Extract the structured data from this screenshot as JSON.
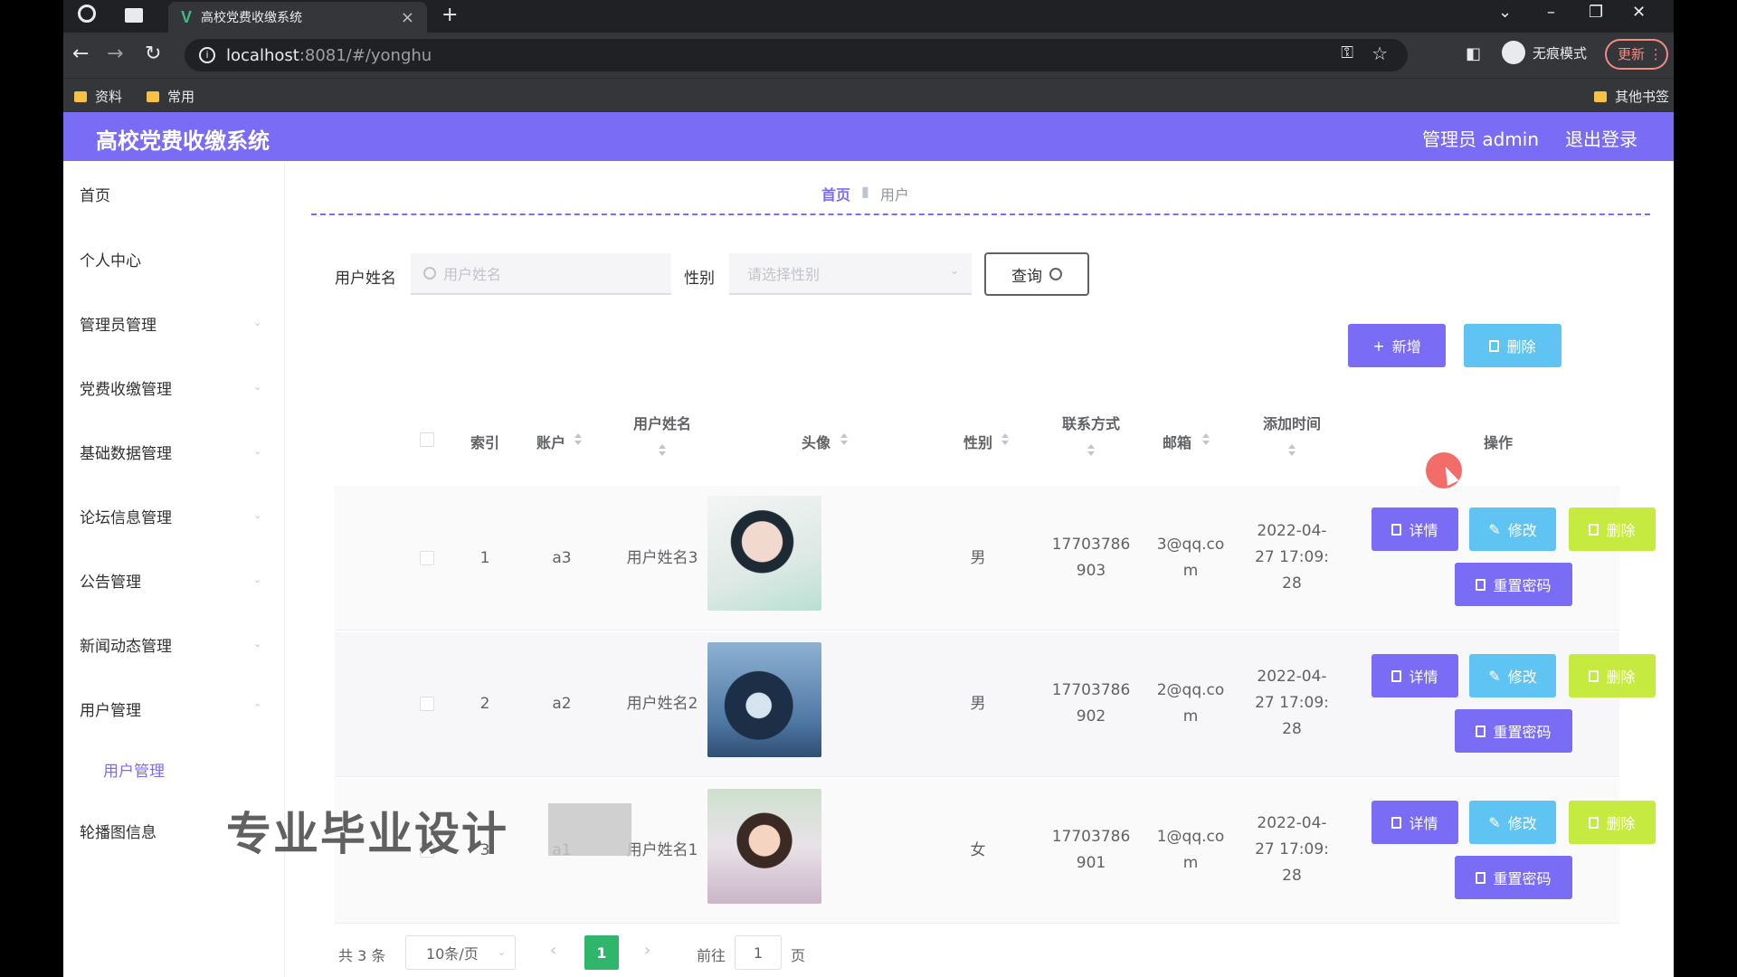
{
  "browser": {
    "tab_title": "高校党费收缴系统",
    "url_host": "localhost",
    "url_rest": ":8081/#/yonghu",
    "incognito_label": "无痕模式",
    "update_label": "更新",
    "bookmarks": [
      "资料",
      "常用"
    ],
    "other_bookmarks": "其他书签"
  },
  "header": {
    "title": "高校党费收缴系统",
    "admin": "管理员 admin",
    "logout": "退出登录"
  },
  "sidebar": {
    "items": [
      "首页",
      "个人中心",
      "管理员管理",
      "党费收缴管理",
      "基础数据管理",
      "论坛信息管理",
      "公告管理",
      "新闻动态管理",
      "用户管理",
      "轮播图信息"
    ],
    "sub_active": "用户管理"
  },
  "breadcrumb": {
    "home": "首页",
    "current": "用户"
  },
  "search": {
    "name_label": "用户姓名",
    "name_placeholder": "用户姓名",
    "gender_label": "性别",
    "gender_placeholder": "请选择性别",
    "query_label": "查询"
  },
  "actions": {
    "add": "新增",
    "delete": "删除"
  },
  "table": {
    "headers": {
      "index": "索引",
      "account": "账户",
      "name": "用户姓名",
      "avatar": "头像",
      "gender": "性别",
      "phone": "联系方式",
      "email": "邮箱",
      "added": "添加时间",
      "ops": "操作"
    },
    "rows": [
      {
        "index": "1",
        "account": "a3",
        "name": "用户姓名3",
        "gender": "男",
        "phone_1": "17703786",
        "phone_2": "903",
        "email_1": "3@qq.co",
        "email_2": "m",
        "time_1": "2022-04-",
        "time_2": "27 17:09:",
        "time_3": "28"
      },
      {
        "index": "2",
        "account": "a2",
        "name": "用户姓名2",
        "gender": "男",
        "phone_1": "17703786",
        "phone_2": "902",
        "email_1": "2@qq.co",
        "email_2": "m",
        "time_1": "2022-04-",
        "time_2": "27 17:09:",
        "time_3": "28"
      },
      {
        "index": "3",
        "account": "a1",
        "name": "用户姓名1",
        "gender": "女",
        "phone_1": "17703786",
        "phone_2": "901",
        "email_1": "1@qq.co",
        "email_2": "m",
        "time_1": "2022-04-",
        "time_2": "27 17:09:",
        "time_3": "28"
      }
    ],
    "op_labels": {
      "detail": "详情",
      "edit": "修改",
      "delete": "删除",
      "reset": "重置密码"
    }
  },
  "pagination": {
    "total": "共 3 条",
    "page_size": "10条/页",
    "current_page": "1",
    "goto_label": "前往",
    "goto_value": "1",
    "page_suffix": "页"
  },
  "watermark": "专业毕业设计"
}
